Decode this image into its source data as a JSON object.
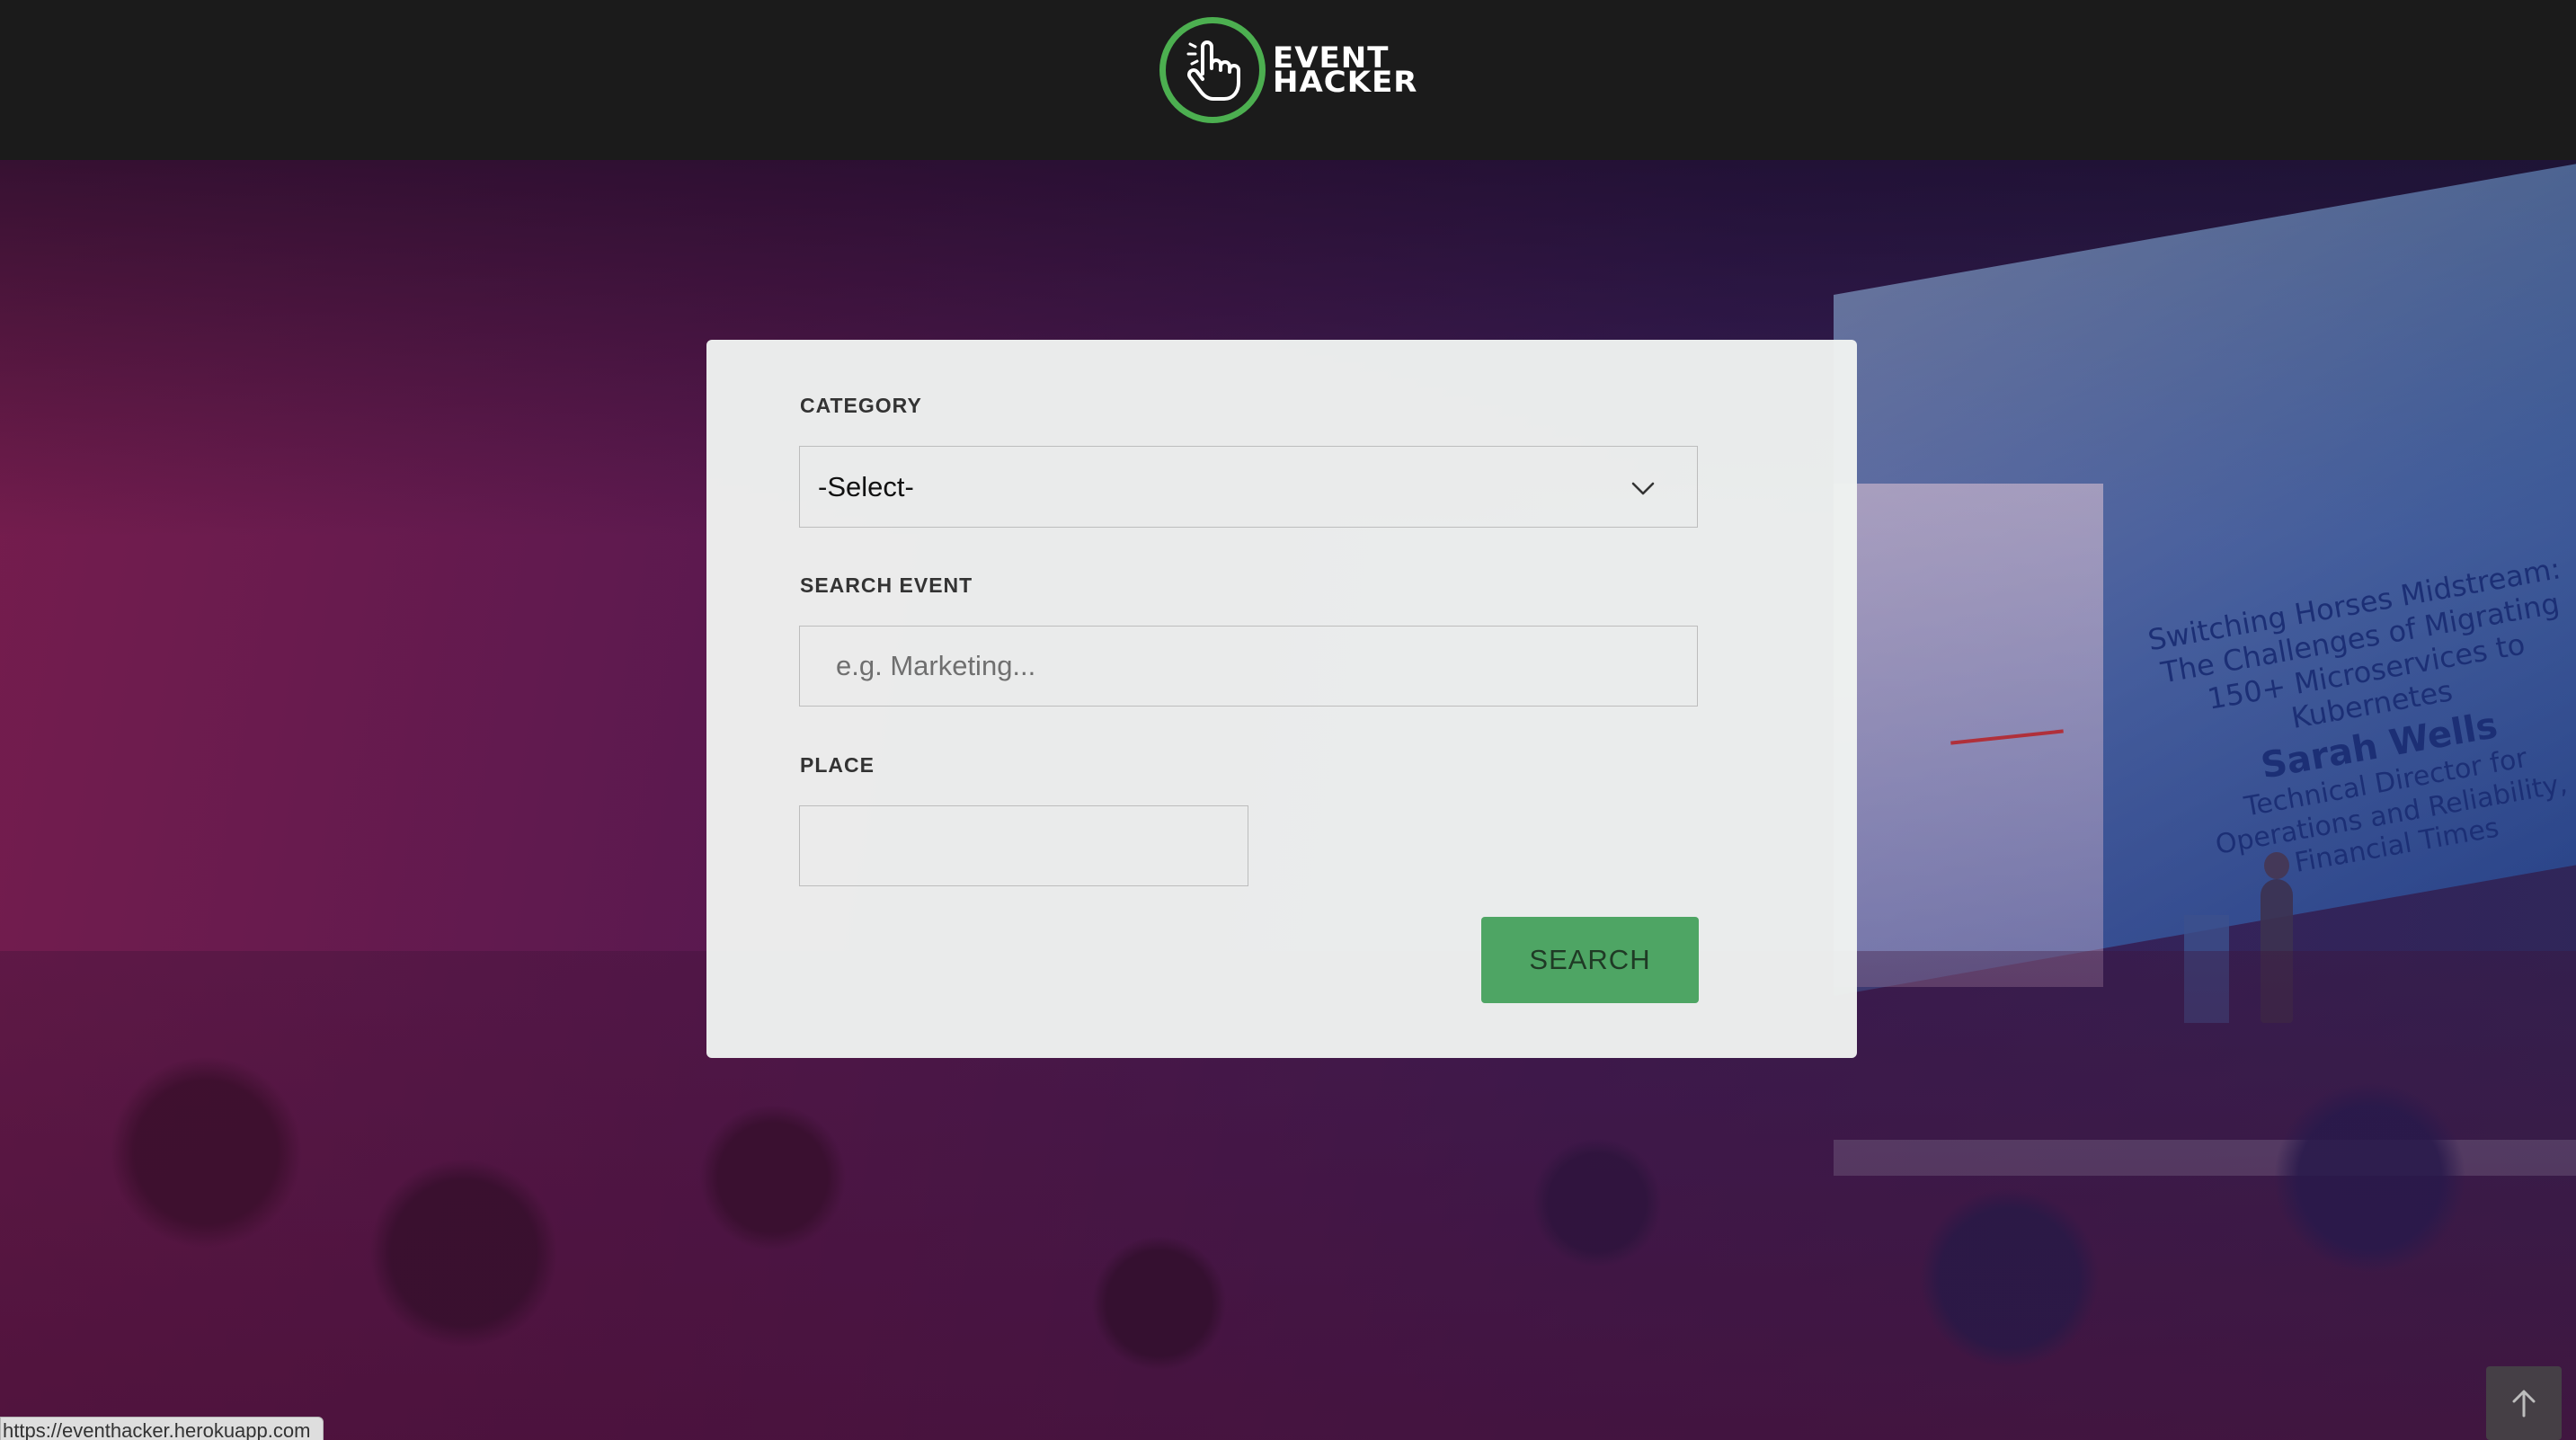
{
  "header": {
    "logo": {
      "line1": "EVENT",
      "line2": "HACKER",
      "icon": "hand-pointer-icon",
      "accent_color": "#4caf50"
    }
  },
  "hero": {
    "background_slide": {
      "line1": "Switching Horses Midstream:",
      "line2": "The Challenges of Migrating",
      "line3": "150+ Microservices to Kubernetes",
      "speaker": "Sarah Wells",
      "role1": "Technical Director for",
      "role2": "Operations and Reliability,",
      "role3": "Financial Times"
    }
  },
  "search_form": {
    "category": {
      "label": "CATEGORY",
      "selected": "-Select-",
      "icon": "chevron-down-icon"
    },
    "search_event": {
      "label": "SEARCH EVENT",
      "placeholder": "e.g. Marketing...",
      "value": ""
    },
    "place": {
      "label": "PLACE",
      "value": ""
    },
    "submit_label": "SEARCH",
    "button_color": "#4ea564"
  },
  "status_bar": {
    "url": "https://eventhacker.herokuapp.com"
  },
  "back_to_top": {
    "icon": "arrow-up-icon"
  }
}
